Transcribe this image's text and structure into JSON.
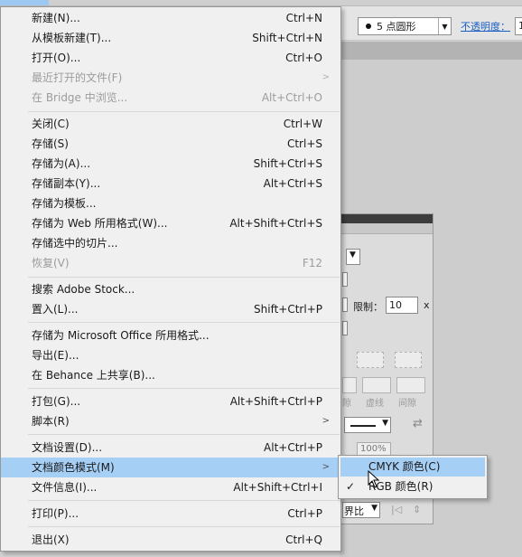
{
  "control_bar": {
    "brush_value": "5 点圆形",
    "opacity_label": "不透明度：",
    "opacity_value": "1"
  },
  "stroke_panel": {
    "limit_label": "限制：",
    "limit_value": "10",
    "limit_suffix": "x",
    "dash_label": "虚线",
    "gap_label": "间隙",
    "dash_faded": "隙",
    "scale_value": "100%",
    "align_value": "界比"
  },
  "file_menu": {
    "items": [
      {
        "label": "新建(N)...",
        "shortcut": "Ctrl+N"
      },
      {
        "label": "从模板新建(T)...",
        "shortcut": "Shift+Ctrl+N"
      },
      {
        "label": "打开(O)...",
        "shortcut": "Ctrl+O"
      },
      {
        "label": "最近打开的文件(F)",
        "shortcut": ""
      },
      {
        "label": "在 Bridge 中浏览...",
        "shortcut": "Alt+Ctrl+O"
      },
      {
        "label": "关闭(C)",
        "shortcut": "Ctrl+W"
      },
      {
        "label": "存储(S)",
        "shortcut": "Ctrl+S"
      },
      {
        "label": "存储为(A)...",
        "shortcut": "Shift+Ctrl+S"
      },
      {
        "label": "存储副本(Y)...",
        "shortcut": "Alt+Ctrl+S"
      },
      {
        "label": "存储为模板...",
        "shortcut": ""
      },
      {
        "label": "存储为 Web 所用格式(W)...",
        "shortcut": "Alt+Shift+Ctrl+S"
      },
      {
        "label": "存储选中的切片...",
        "shortcut": ""
      },
      {
        "label": "恢复(V)",
        "shortcut": "F12"
      },
      {
        "label": "搜索 Adobe Stock...",
        "shortcut": ""
      },
      {
        "label": "置入(L)...",
        "shortcut": "Shift+Ctrl+P"
      },
      {
        "label": "存储为 Microsoft Office 所用格式...",
        "shortcut": ""
      },
      {
        "label": "导出(E)...",
        "shortcut": ""
      },
      {
        "label": "在 Behance 上共享(B)...",
        "shortcut": ""
      },
      {
        "label": "打包(G)...",
        "shortcut": "Alt+Shift+Ctrl+P"
      },
      {
        "label": "脚本(R)",
        "shortcut": ""
      },
      {
        "label": "文档设置(D)...",
        "shortcut": "Alt+Ctrl+P"
      },
      {
        "label": "文档颜色模式(M)",
        "shortcut": ""
      },
      {
        "label": "文件信息(I)...",
        "shortcut": "Alt+Shift+Ctrl+I"
      },
      {
        "label": "打印(P)...",
        "shortcut": "Ctrl+P"
      },
      {
        "label": "退出(X)",
        "shortcut": "Ctrl+Q"
      }
    ]
  },
  "color_submenu": {
    "items": [
      {
        "label": "CMYK 颜色(C)",
        "checked": false
      },
      {
        "label": "RGB 颜色(R)",
        "checked": true
      }
    ]
  },
  "colors": {
    "highlight": "#a6cff5",
    "menu_bg": "#f0f0f0",
    "disabled_text": "#9c9c9c",
    "link": "#1a5fc4"
  }
}
